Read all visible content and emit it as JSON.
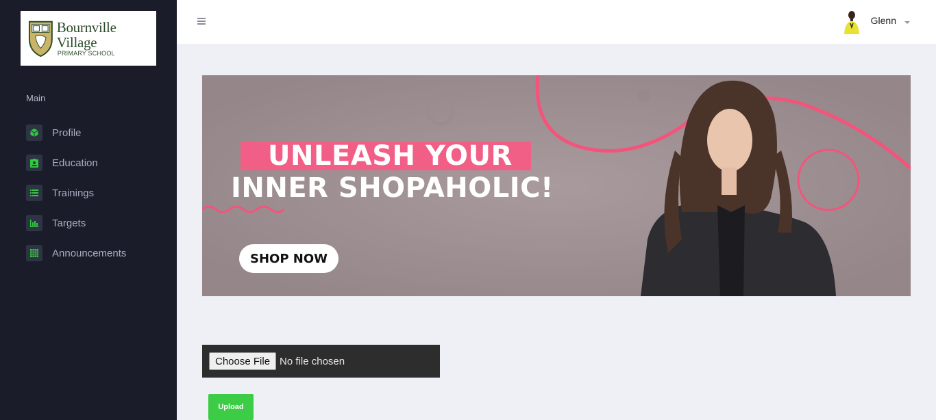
{
  "logo": {
    "name": "Bournville Village",
    "subtitle": "PRIMARY SCHOOL"
  },
  "sidebar": {
    "section_title": "Main",
    "items": [
      {
        "label": "Profile",
        "icon": "cube-icon"
      },
      {
        "label": "Education",
        "icon": "id-card-icon"
      },
      {
        "label": "Trainings",
        "icon": "list-icon"
      },
      {
        "label": "Targets",
        "icon": "bar-chart-icon"
      },
      {
        "label": "Announcements",
        "icon": "calendar-grid-icon"
      }
    ]
  },
  "header": {
    "user_name": "Glenn"
  },
  "banner": {
    "headline_1": "UNLEASH YOUR",
    "headline_2": "INNER SHOPAHOLIC!",
    "cta": "SHOP NOW"
  },
  "upload": {
    "choose_label": "Choose File",
    "status": "No file chosen",
    "button_label": "Upload"
  },
  "colors": {
    "sidebar": "#1b1c2a",
    "accent_green": "#3ccc45",
    "banner_pink": "#f25f86"
  }
}
